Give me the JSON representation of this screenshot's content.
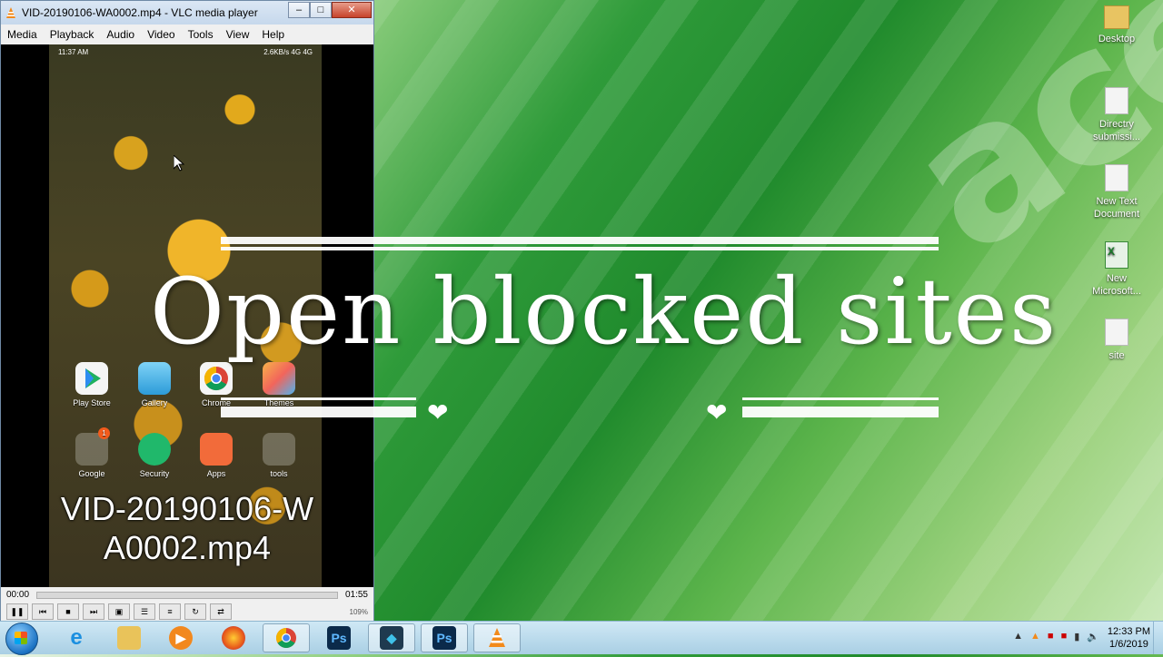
{
  "vlc": {
    "title": "VID-20190106-WA0002.mp4 - VLC media player",
    "menu": [
      "Media",
      "Playback",
      "Audio",
      "Video",
      "Tools",
      "View",
      "Help"
    ],
    "phone_status_left": "11:37 AM",
    "phone_status_right": "2.6KB/s 4G 4G",
    "apps_row1": [
      "Play Store",
      "Gallery",
      "Chrome",
      "Themes"
    ],
    "apps_row2": [
      "Google",
      "Security",
      "Apps",
      "tools"
    ],
    "badge": "1",
    "caption_line1": "VID-20190106-W",
    "caption_line2": "A0002.mp4",
    "time_elapsed": "00:00",
    "time_total": "01:55",
    "volume": "109%"
  },
  "overlay": {
    "title": "Open blocked sites"
  },
  "desktop": {
    "icons": [
      "Desktop",
      "Directry submissi...",
      "New Text Document",
      "New Microsoft...",
      "site"
    ]
  },
  "taskbar": {
    "time": "12:33 PM",
    "date": "1/6/2019",
    "apps": [
      "internet-explorer",
      "file-explorer",
      "media-player",
      "firefox",
      "chrome",
      "photoshop",
      "kodi",
      "photoshop",
      "vlc"
    ]
  }
}
